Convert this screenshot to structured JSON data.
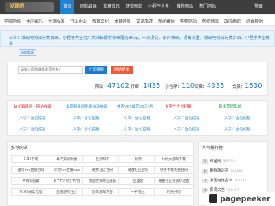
{
  "header": {
    "logo_text": "发现吧",
    "nav": [
      "首页",
      "网站目录",
      "文章资讯",
      "快审网站",
      "小程序大全",
      "推荐网站",
      "热门网站"
    ],
    "login": "登录"
  },
  "categories": [
    "电脑网络",
    "休闲娱乐",
    "生活服务",
    "行业企业",
    "教育文化",
    "体育健身",
    "交通旅游",
    "新闻媒体",
    "购物网站",
    "医疗健康",
    "政府组织",
    "综合其他"
  ],
  "notice": {
    "text": "公告：发现吧网站分类目录、小程序大全为广大站长提供快审服务30元。一次提交，永久收录，提高流量，发现吧网站分类目录、小程序大全优秀",
    "qq_label": "QQ交谈"
  },
  "search": {
    "placeholder": "请输入网站或关键词搜索！",
    "search_btn": "立即搜索",
    "submit_btn": "网站提交"
  },
  "stats": [
    {
      "label": "网站：",
      "value": "47102"
    },
    {
      "label": "待审：",
      "value": "1435"
    },
    {
      "label": "小程序：",
      "value": "110"
    },
    {
      "label": "文章：",
      "value": "4335"
    },
    {
      "label": "会员：",
      "value": "1530"
    }
  ],
  "ads": {
    "row1": [
      "站长目录网 · 网站收录",
      "发现目录网免费自动收录",
      "美国VPS最低50元/月",
      "文字广告位招租",
      "首维营销系统"
    ],
    "placeholder": "文字广告位招租",
    "colors": [
      "#e02020",
      "#2c8fd8",
      "#2c8fd8",
      "#e02020",
      "#2ea84b"
    ]
  },
  "recommended": {
    "title": "推荐网站",
    "sites": [
      "1.36下载",
      "耳内式助听器",
      "股票知识",
      "我校",
      "lc网页游戏下载",
      "盘马live直播官网",
      "探花live直播app",
      "雅群社区官网",
      "雅群社区官网",
      "快手下载免费官网",
      "不锈钢烟囱",
      "果子TV-果子TV官",
      "加盟连锁商业连锁",
      "星座音",
      "雅群社区免费体验直",
      "9103网站导航",
      "星游游戏社区",
      "原来游戏平台",
      "一种社区",
      "时光外贸"
    ]
  },
  "rank": {
    "title": "人气排行榜",
    "items": [
      {
        "idx": "1",
        "name": "球星网",
        "val": "968759"
      },
      {
        "idx": "2",
        "name": "群群球迷网",
        "val": "760234"
      },
      {
        "idx": "3",
        "name": "中国电信企业",
        "val": "758623"
      },
      {
        "idx": "4",
        "name": "影视大全",
        "val": "658457"
      }
    ]
  },
  "watermark": "pagepeeker"
}
